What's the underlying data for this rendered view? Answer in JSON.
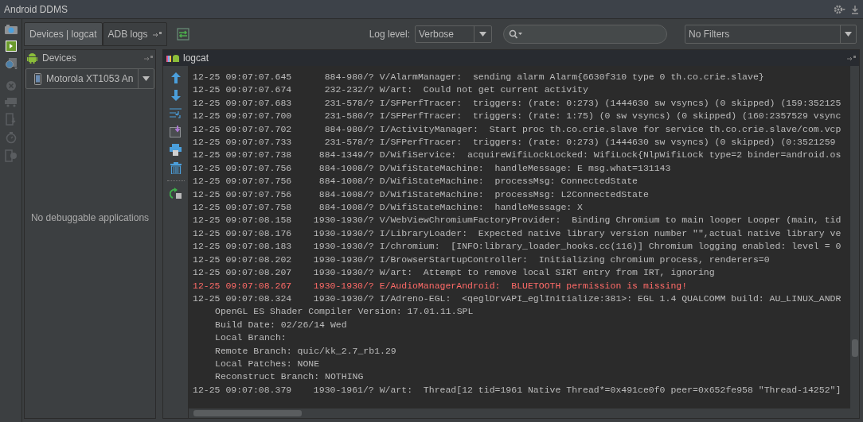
{
  "window": {
    "title": "Android DDMS"
  },
  "tabs": [
    {
      "label": "Devices | logcat",
      "selected": true
    },
    {
      "label": "ADB logs",
      "selected": false
    }
  ],
  "log_level": {
    "label": "Log level:",
    "value": "Verbose"
  },
  "filter": {
    "value": "No Filters"
  },
  "devices_panel": {
    "title": "Devices",
    "device": "Motorola XT1053 An",
    "empty_message": "No debuggable applications"
  },
  "logcat": {
    "title": "logcat",
    "rows": [
      {
        "kind": "entry",
        "text": "12-25 09:07:07.645      884-980/? V/AlarmManager:  sending alarm Alarm{6630f310 type 0 th.co.crie.slave}"
      },
      {
        "kind": "entry",
        "text": "12-25 09:07:07.674      232-232/? W/art:  Could not get current activity"
      },
      {
        "kind": "entry",
        "text": "12-25 09:07:07.683      231-578/? I/SFPerfTracer:  triggers: (rate: 0:273) (1444630 sw vsyncs) (0 skipped) (159:352125"
      },
      {
        "kind": "entry",
        "text": "12-25 09:07:07.700      231-580/? I/SFPerfTracer:  triggers: (rate: 1:75) (0 sw vsyncs) (0 skipped) (160:2357529 vsync"
      },
      {
        "kind": "entry",
        "text": "12-25 09:07:07.702      884-980/? I/ActivityManager:  Start proc th.co.crie.slave for service th.co.crie.slave/com.vcp"
      },
      {
        "kind": "entry",
        "text": "12-25 09:07:07.733      231-578/? I/SFPerfTracer:  triggers: (rate: 0:273) (1444630 sw vsyncs) (0 skipped) (0:3521259"
      },
      {
        "kind": "entry",
        "text": "12-25 09:07:07.738     884-1349/? D/WifiService:  acquireWifiLockLocked: WifiLock{NlpWifiLock type=2 binder=android.os"
      },
      {
        "kind": "entry",
        "text": "12-25 09:07:07.756     884-1008/? D/WifiStateMachine:  handleMessage: E msg.what=131143"
      },
      {
        "kind": "entry",
        "text": "12-25 09:07:07.756     884-1008/? D/WifiStateMachine:  processMsg: ConnectedState"
      },
      {
        "kind": "entry",
        "text": "12-25 09:07:07.756     884-1008/? D/WifiStateMachine:  processMsg: L2ConnectedState"
      },
      {
        "kind": "entry",
        "text": "12-25 09:07:07.758     884-1008/? D/WifiStateMachine:  handleMessage: X"
      },
      {
        "kind": "entry",
        "text": "12-25 09:07:08.158    1930-1930/? V/WebViewChromiumFactoryProvider:  Binding Chromium to main looper Looper (main, tid"
      },
      {
        "kind": "entry",
        "text": "12-25 09:07:08.176    1930-1930/? I/LibraryLoader:  Expected native library version number \"\",actual native library ve"
      },
      {
        "kind": "entry",
        "text": "12-25 09:07:08.183    1930-1930/? I/chromium:  [INFO:library_loader_hooks.cc(116)] Chromium logging enabled: level = 0"
      },
      {
        "kind": "entry",
        "text": "12-25 09:07:08.202    1930-1930/? I/BrowserStartupController:  Initializing chromium process, renderers=0"
      },
      {
        "kind": "entry",
        "text": "12-25 09:07:08.207    1930-1930/? W/art:  Attempt to remove local SIRT entry from IRT, ignoring"
      },
      {
        "kind": "error",
        "text": "12-25 09:07:08.267    1930-1930/? E/AudioManagerAndroid:  BLUETOOTH permission is missing!"
      },
      {
        "kind": "entry",
        "text": "12-25 09:07:08.324    1930-1930/? I/Adreno-EGL:  <qeglDrvAPI_eglInitialize:381>: EGL 1.4 QUALCOMM build: AU_LINUX_ANDR"
      },
      {
        "kind": "continuation",
        "text": "OpenGL ES Shader Compiler Version: 17.01.11.SPL"
      },
      {
        "kind": "continuation",
        "text": "Build Date: 02/26/14 Wed"
      },
      {
        "kind": "continuation",
        "text": "Local Branch:"
      },
      {
        "kind": "continuation",
        "text": "Remote Branch: quic/kk_2.7_rb1.29"
      },
      {
        "kind": "continuation",
        "text": "Local Patches: NONE"
      },
      {
        "kind": "continuation",
        "text": "Reconstruct Branch: NOTHING"
      },
      {
        "kind": "entry",
        "text": "12-25 09:07:08.379    1930-1961/? W/art:  Thread[12 tid=1961 Native Thread*=0x491ce0f0 peer=0x652fe958 \"Thread-14252\"]"
      }
    ]
  }
}
